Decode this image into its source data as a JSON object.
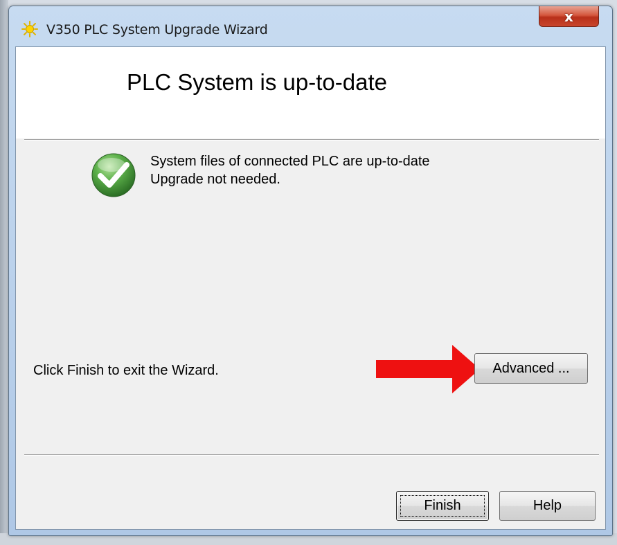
{
  "window": {
    "title": "V350 PLC System Upgrade Wizard",
    "close_label": "x"
  },
  "header": {
    "title": "PLC System is up-to-date"
  },
  "status": {
    "line1": "System files of connected PLC are up-to-date",
    "line2": "Upgrade not needed."
  },
  "body": {
    "instruction": "Click Finish to exit the Wizard.",
    "advanced_label": "Advanced ..."
  },
  "footer": {
    "finish_label": "Finish",
    "help_label": "Help"
  },
  "icons": {
    "title": "sun-icon",
    "status": "checkmark-icon",
    "annotation": "red-arrow-icon"
  },
  "colors": {
    "accent_red": "#ee1111",
    "check_green": "#3b9a3b"
  }
}
